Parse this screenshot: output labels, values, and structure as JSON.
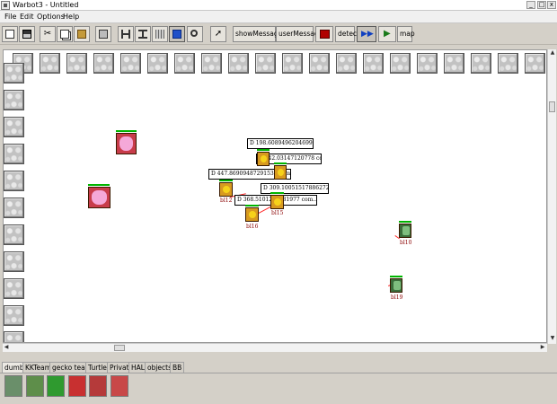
{
  "window": {
    "title": "Warbot3 - Untitled",
    "controls": [
      "_",
      "□",
      "x"
    ]
  },
  "menu": {
    "file": "File",
    "edit": "Edit",
    "options": "Options",
    "help": "Help"
  },
  "toolbar": {
    "show_messages": "showMessages",
    "user_message": "userMessage",
    "detect": "detect",
    "map": "map",
    "icons": [
      "new-file-icon",
      "save-icon",
      "cut-icon",
      "copy-icon",
      "paste-icon",
      "print-icon",
      "align-horizontal-icon",
      "align-vertical-icon",
      "grid-icon",
      "fit-view-icon",
      "zoom-icon",
      "pointer-icon",
      "stop-icon",
      "step-icon",
      "play-icon"
    ]
  },
  "arena": {
    "robots": [
      {
        "id": "pink-1",
        "kind": "home-base",
        "team_color": "#d84a4a",
        "label": ""
      },
      {
        "id": "pink-2",
        "kind": "home-base",
        "team_color": "#d84a4a",
        "label": ""
      },
      {
        "id": "y-top",
        "kind": "explorer",
        "team_color": "#e6b800",
        "label": ""
      },
      {
        "id": "y-mid",
        "kind": "explorer",
        "team_color": "#e6b800",
        "label": ""
      },
      {
        "id": "bl12",
        "kind": "explorer",
        "team_color": "#e6b800",
        "label": "bl12"
      },
      {
        "id": "bl15",
        "kind": "explorer",
        "team_color": "#e6b800",
        "label": "bl15"
      },
      {
        "id": "bl16",
        "kind": "explorer",
        "team_color": "#e6b800",
        "label": "bl16"
      },
      {
        "id": "bl10",
        "kind": "rocket-launcher",
        "team_color": "#2e7d32",
        "label": "bl10"
      },
      {
        "id": "bl19",
        "kind": "rocket-launcher",
        "team_color": "#2e7d32",
        "label": "bl19"
      }
    ],
    "distance_boxes": [
      {
        "text": "D 198.60894962046996 com.."
      },
      {
        "text": "D 242.03147120778 compt.."
      },
      {
        "text": "D 447.86909487291531 comp.."
      },
      {
        "text": "D 309.10051517886272 comp.."
      },
      {
        "text": "D 368.5101231881977 com.."
      }
    ]
  },
  "tabs": [
    "dumb",
    "KKTeam",
    "gecko team",
    "Turtle",
    "Privat",
    "HAL",
    "objects",
    "BB"
  ],
  "active_tab": "dumb",
  "palette": [
    "rocket-launcher-unit-icon",
    "explorer-unit-icon",
    "base-green-icon",
    "base-red-icon",
    "robot-red-icon",
    "tool-unit-icon"
  ]
}
